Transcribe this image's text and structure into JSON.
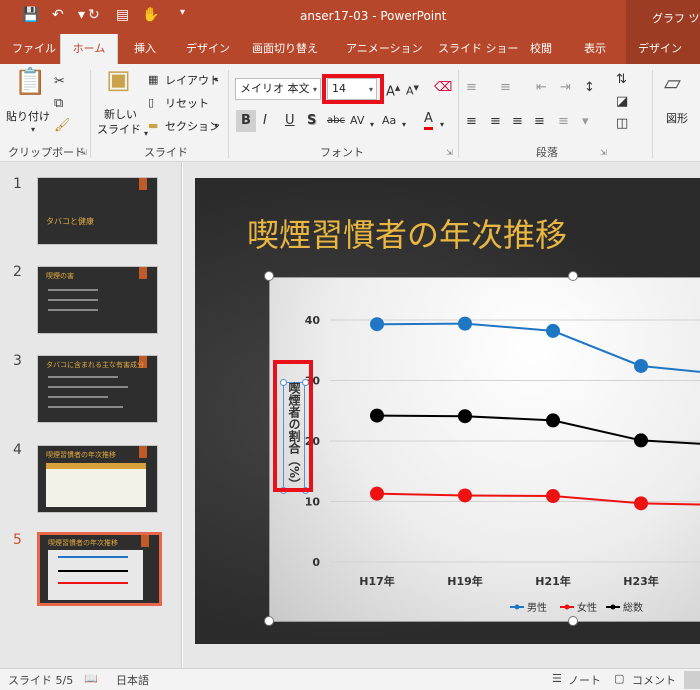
{
  "titlebar": {
    "doc_title": "anser17-03  -  PowerPoint",
    "context_tab": "グラフ ツー",
    "save_icon": "save-icon",
    "undo_icon": "undo-icon",
    "redo_icon": "redo-icon"
  },
  "tabs": {
    "file": "ファイル",
    "home": "ホーム",
    "insert": "挿入",
    "design": "デザイン",
    "transitions": "画面切り替え",
    "animations": "アニメーション",
    "slideshow": "スライド ショー",
    "review": "校閲",
    "view": "表示",
    "chart_design": "デザイン"
  },
  "ribbon": {
    "paste": "貼り付け",
    "clipboard": "クリップボード",
    "new_slide_1": "新しい",
    "new_slide_2": "スライド",
    "layout": "レイアウト",
    "reset": "リセット",
    "section": "セクション",
    "slides": "スライド",
    "font_name": "メイリオ 本文",
    "font_size": "14",
    "font_group": "フォント",
    "paragraph": "段落",
    "shapes": "図形",
    "bold": "B",
    "italic": "I",
    "underline": "U",
    "shadow": "S",
    "strike": "abc",
    "spacing": "AV",
    "case": "Aa",
    "font_color": "A"
  },
  "thumbnails": [
    {
      "num": "1",
      "title": "タバコと健康"
    },
    {
      "num": "2",
      "title": "喫煙の害"
    },
    {
      "num": "3",
      "title": "タバコに含まれる主な有害成分"
    },
    {
      "num": "4",
      "title": "喫煙習慣者の年次推移"
    },
    {
      "num": "5",
      "title": "喫煙習慣者の年次推移"
    }
  ],
  "slide": {
    "title": "喫煙習慣者の年次推移"
  },
  "chart_data": {
    "type": "line",
    "categories": [
      "H17年",
      "H19年",
      "H21年",
      "H23年"
    ],
    "series": [
      {
        "name": "男性",
        "values": [
          39.3,
          39.4,
          38.2,
          32.4
        ],
        "color": "#1f77c4"
      },
      {
        "name": "女性",
        "values": [
          11.3,
          11.0,
          10.9,
          9.7
        ],
        "color": "#ee1111"
      },
      {
        "name": "総数",
        "values": [
          24.2,
          24.1,
          23.4,
          20.1
        ],
        "color": "#000000"
      }
    ],
    "ylabel": "喫煙者の割合（%）",
    "yticks": [
      "0",
      "10",
      "20",
      "30",
      "40"
    ],
    "ylim": [
      0,
      40
    ],
    "legend_position": "bottom"
  },
  "status": {
    "slide_count": "スライド 5/5",
    "language": "日本語",
    "notes": "ノート",
    "comments": "コメント"
  }
}
